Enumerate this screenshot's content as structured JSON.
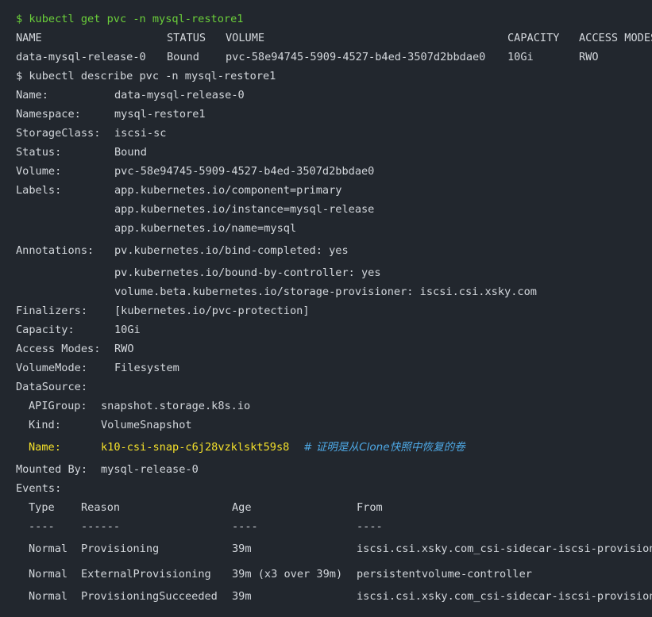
{
  "cmd1": "$ kubectl get pvc -n mysql-restore1",
  "get_table": {
    "headers": [
      "NAME",
      "STATUS",
      "VOLUME",
      "CAPACITY",
      "ACCESS MODES"
    ],
    "row": [
      "data-mysql-release-0",
      "Bound",
      "pvc-58e94745-5909-4527-b4ed-3507d2bbdae0",
      "10Gi",
      "RWO"
    ]
  },
  "cmd2": "$ kubectl describe pvc -n mysql-restore1",
  "describe": {
    "name_key": "Name:",
    "name_val": "data-mysql-release-0",
    "ns_key": "Namespace:",
    "ns_val": "mysql-restore1",
    "sc_key": "StorageClass:",
    "sc_val": "iscsi-sc",
    "status_key": "Status:",
    "status_val": "Bound",
    "volume_key": "Volume:",
    "volume_val": "pvc-58e94745-5909-4527-b4ed-3507d2bbdae0",
    "labels_key": "Labels:",
    "labels": [
      "app.kubernetes.io/component=primary",
      "app.kubernetes.io/instance=mysql-release",
      "app.kubernetes.io/name=mysql"
    ],
    "annotations_key": "Annotations:",
    "annotations": [
      "pv.kubernetes.io/bind-completed: yes",
      "pv.kubernetes.io/bound-by-controller: yes",
      "volume.beta.kubernetes.io/storage-provisioner: iscsi.csi.xsky.com"
    ],
    "finalizers_key": "Finalizers:",
    "finalizers_val": "[kubernetes.io/pvc-protection]",
    "capacity_key": "Capacity:",
    "capacity_val": "10Gi",
    "access_key": "Access Modes:",
    "access_val": "RWO",
    "vm_key": "VolumeMode:",
    "vm_val": "Filesystem",
    "ds_key": "DataSource:",
    "apigroup_key": "APIGroup:",
    "apigroup_val": "snapshot.storage.k8s.io",
    "kind_key": "Kind:",
    "kind_val": "VolumeSnapshot",
    "dsname_key": "Name:",
    "dsname_val": "k10-csi-snap-c6j28vzklskt59s8",
    "comment": "# 证明是从Clone快照中恢复的卷",
    "mounted_key": "Mounted By:",
    "mounted_val": "mysql-release-0",
    "events_key": "Events:"
  },
  "events": {
    "headers": [
      "Type",
      "Reason",
      "Age",
      "From"
    ],
    "dashes": [
      "----",
      "------",
      "----",
      "----"
    ],
    "rows": [
      [
        "Normal",
        "Provisioning",
        "39m",
        "iscsi.csi.xsky.com_csi-sidecar-iscsi-provisioner"
      ],
      [
        "Normal",
        "ExternalProvisioning",
        "39m (x3 over 39m)",
        "persistentvolume-controller"
      ],
      [
        "Normal",
        "ProvisioningSucceeded",
        "39m",
        "iscsi.csi.xsky.com_csi-sidecar-iscsi-provisioner"
      ]
    ]
  }
}
